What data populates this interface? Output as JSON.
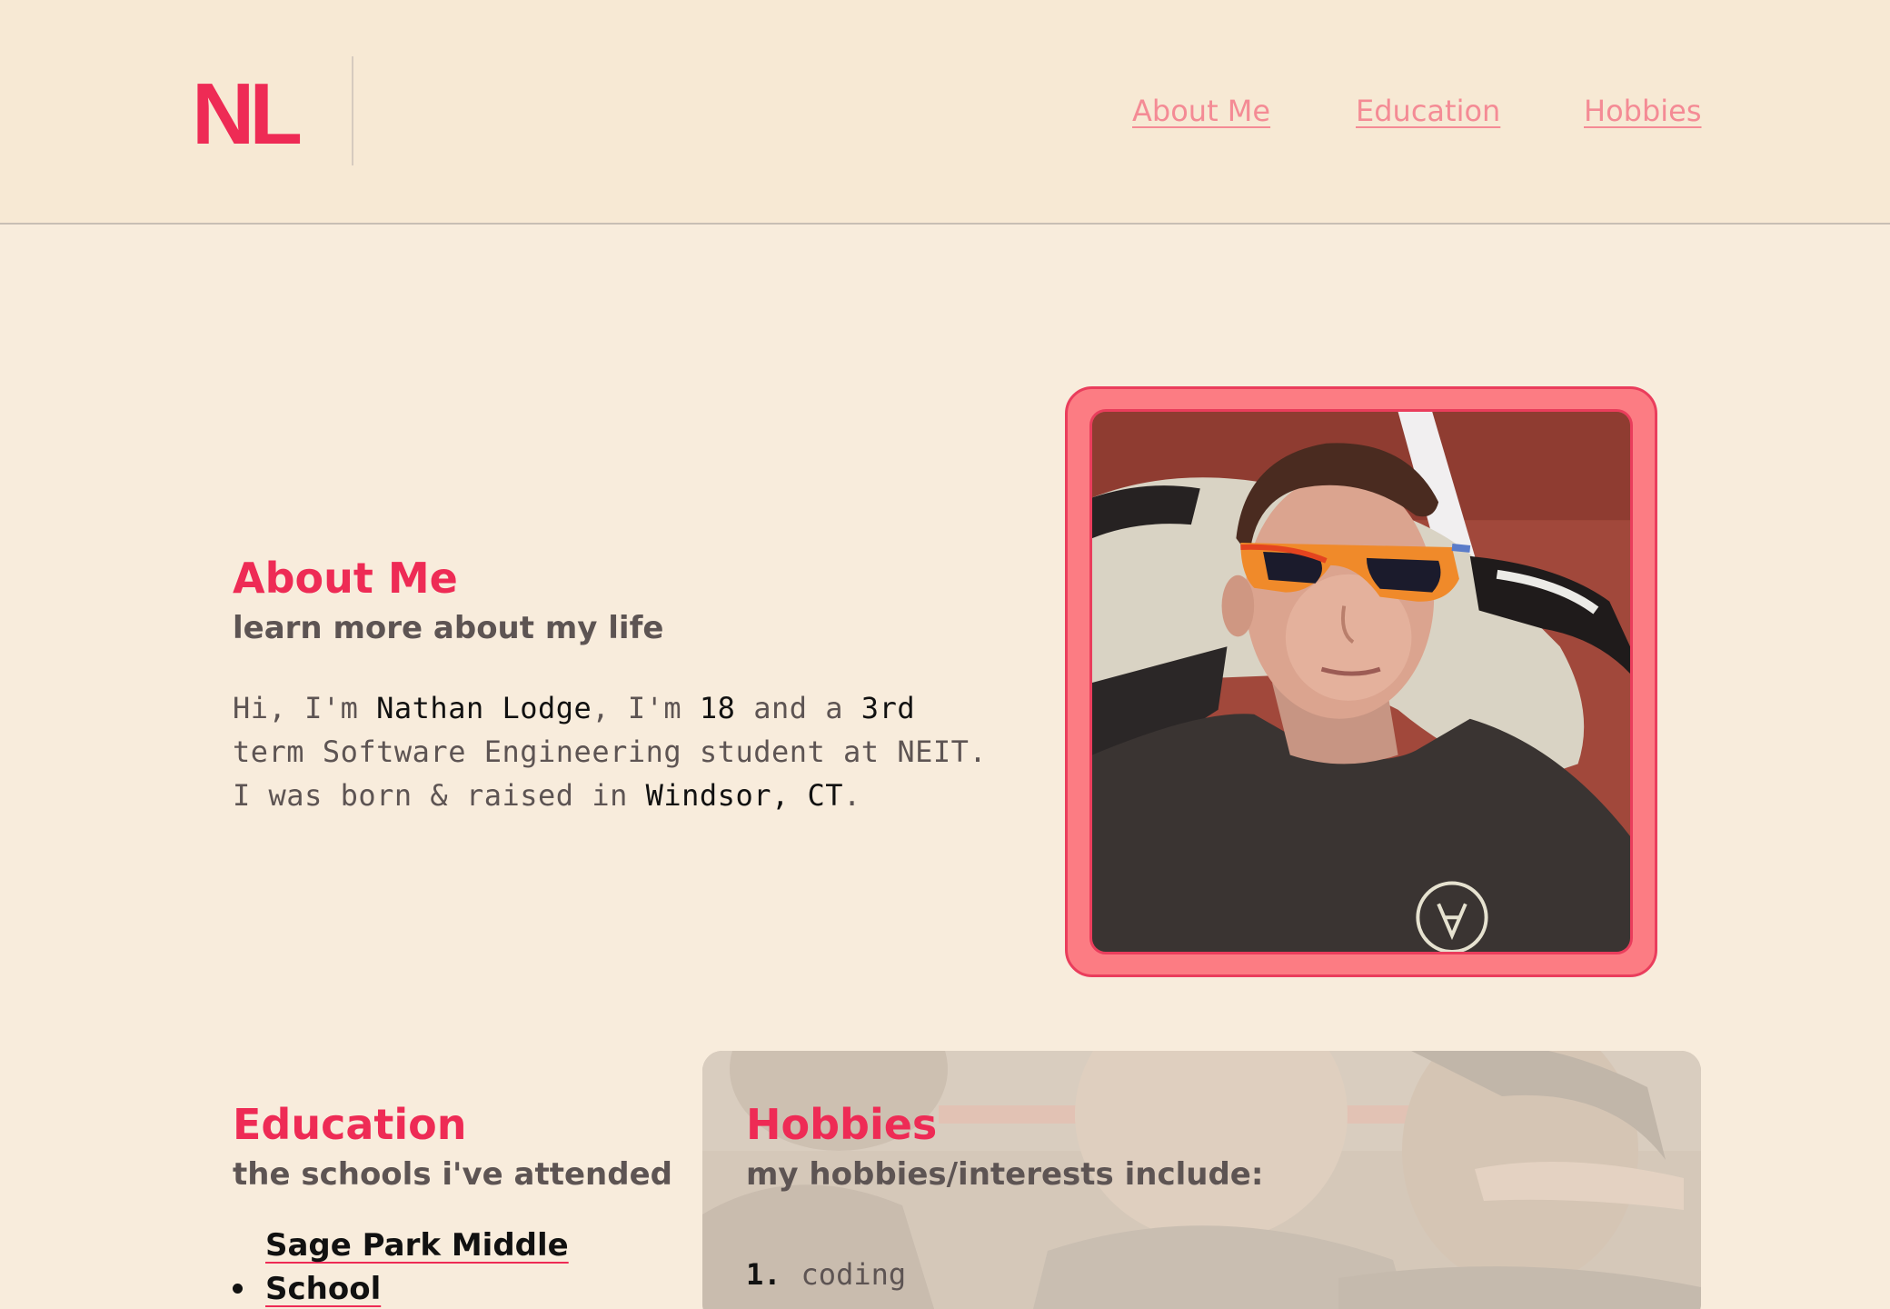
{
  "header": {
    "logo": "NL",
    "nav": [
      {
        "label": "About Me"
      },
      {
        "label": "Education"
      },
      {
        "label": "Hobbies"
      }
    ]
  },
  "about": {
    "title": "About Me",
    "subtitle": "learn more about my life",
    "body": {
      "t1": "Hi, I'm ",
      "name": "Nathan Lodge",
      "t2": ", I'm ",
      "age": "18",
      "t3": " and a ",
      "term": "3rd",
      "t4": " term Software Engineering student at NEIT. I was born & raised in ",
      "hometown": "Windsor, CT",
      "t5": "."
    },
    "photo_alt": "photo of Nathan wearing eclipse glasses"
  },
  "education": {
    "title": "Education",
    "subtitle": "the schools i've attended",
    "schools": [
      {
        "line1": "Sage Park Middle",
        "line2": "School"
      }
    ]
  },
  "hobbies": {
    "title": "Hobbies",
    "subtitle": "my hobbies/interests include:",
    "items": [
      {
        "num": "1.",
        "label": "coding"
      }
    ]
  },
  "colors": {
    "background": "#f8ecdc",
    "header_background": "#f7e9d4",
    "accent": "#ee2b55",
    "nav_link": "#f48b95",
    "photo_frame": "#fc7c83",
    "muted_text": "#5d5453"
  }
}
